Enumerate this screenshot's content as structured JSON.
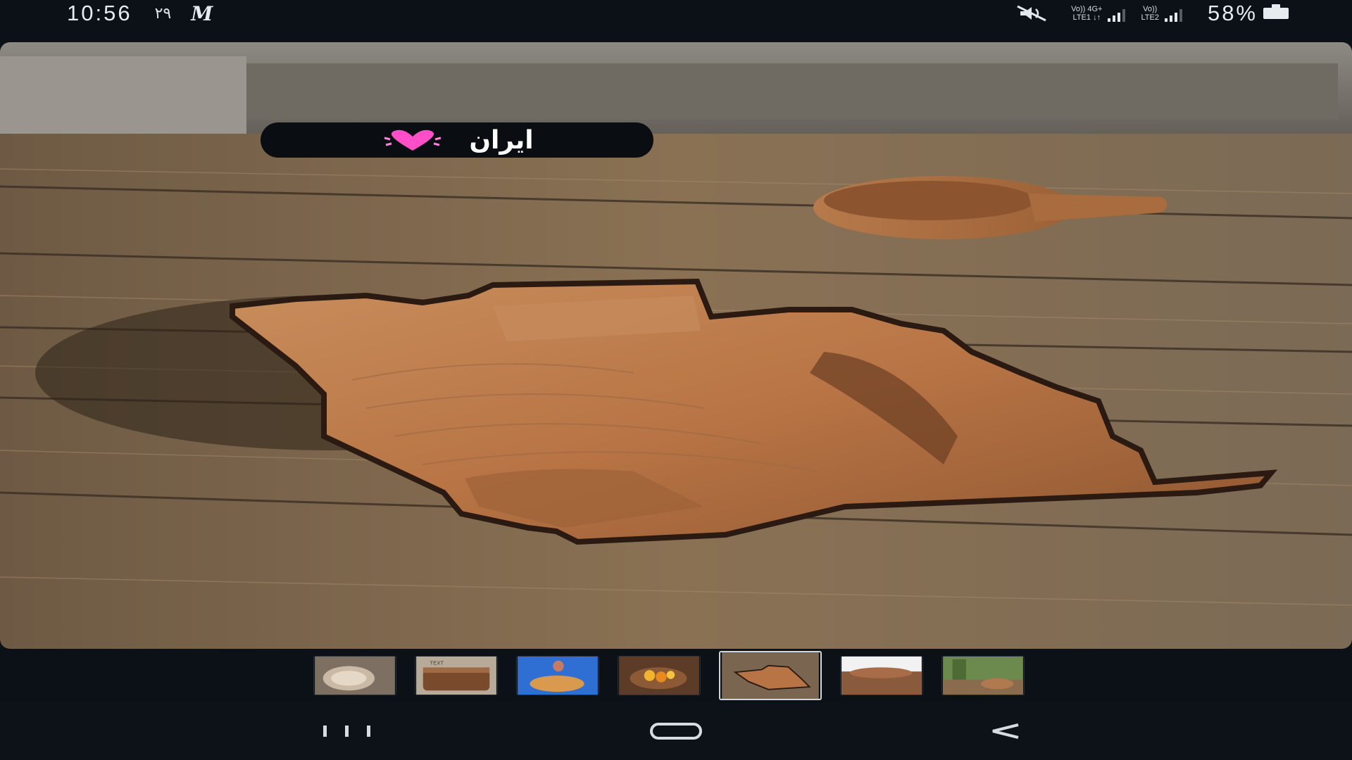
{
  "status_bar": {
    "time": "10:56",
    "date": "۲۹",
    "app_logo_text": "M",
    "sim1_top": "Vo)) 4G+",
    "sim1_bottom": "LTE1 ↓↑",
    "sim2_top": "Vo))",
    "sim2_bottom": "LTE2",
    "battery": "58%",
    "icons": [
      "mute-icon",
      "signal-icon",
      "battery-icon"
    ]
  },
  "photo": {
    "sticker_text": "ایران",
    "sticker_icon": "pink-heart-icon",
    "colors": {
      "sticker_bg": "#0a0d11",
      "heart": "#ff4fc8"
    }
  },
  "thumbnails": {
    "items": [
      {
        "label": "thumb-1"
      },
      {
        "label": "thumb-2"
      },
      {
        "label": "thumb-3"
      },
      {
        "label": "thumb-4"
      },
      {
        "label": "thumb-5",
        "selected": true
      },
      {
        "label": "thumb-6"
      },
      {
        "label": "thumb-7"
      }
    ]
  },
  "nav_bar": {
    "buttons": [
      "recent-apps-icon",
      "home-icon",
      "back-icon"
    ]
  }
}
